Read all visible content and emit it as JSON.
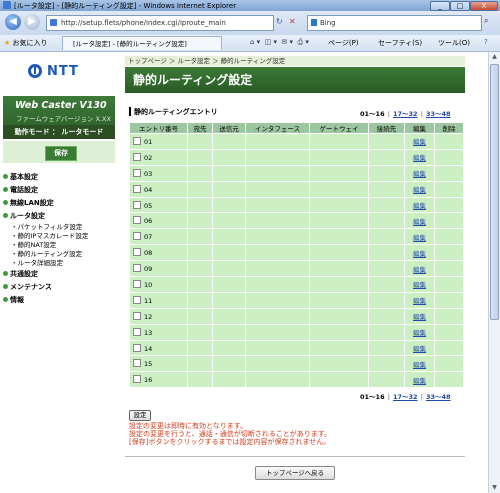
{
  "window": {
    "title": "[ルータ設定] - [静的ルーティング設定] - Windows Internet Explorer",
    "minimize": "_",
    "maximize": "□",
    "close": "X"
  },
  "address_bar": {
    "url": "http://setup.flets/phone/index.cgi/iproute_main",
    "search_provider": "Bing",
    "back_icon": "back-arrow-icon",
    "forward_icon": "forward-arrow-icon",
    "refresh": "↻",
    "stop": "✕",
    "search_icon": "search-icon"
  },
  "favorites_bar": {
    "favorites_label": "お気に入り",
    "tab_title": "[ルータ設定] - [静的ルーティング設定]",
    "page_menu": "ページ(P)",
    "safety_menu": "セーフティ(S)",
    "tools_menu": "ツール(O)",
    "help_menu": "?"
  },
  "sidebar": {
    "logo_text": "NTT",
    "product_name": "Web Caster V130",
    "firmware": "ファームウェアバージョン X.XX",
    "mode": "動作モード ： ルータモード",
    "save_label": "保存",
    "menu": [
      {
        "label": "基本設定"
      },
      {
        "label": "電話設定"
      },
      {
        "label": "無線LAN設定"
      },
      {
        "label": "ルータ設定"
      }
    ],
    "router_submenu": [
      "・パケットフィルタ設定",
      "・静的IPマスカレード設定",
      "・静的NAT設定",
      "・静的ルーティング設定",
      "・ルータ詳細設定"
    ],
    "menu_after": [
      {
        "label": "共通設定"
      },
      {
        "label": "メンテナンス"
      },
      {
        "label": "情報"
      }
    ]
  },
  "main": {
    "breadcrumb": "トップページ ＞ ルータ設定 ＞ 静的ルーティング設定",
    "title": "静的ルーティング設定",
    "section": "静的ルーティングエントリ",
    "pager": {
      "current": "01～16",
      "p2": "17～32",
      "p3": "33～48"
    },
    "columns": [
      "エントリ番号",
      "宛先",
      "送信元",
      "インタフェース",
      "ゲートウェイ",
      "接続先",
      "編集",
      "削除"
    ],
    "rows": [
      {
        "num": "01",
        "edit": "編集"
      },
      {
        "num": "02",
        "edit": "編集"
      },
      {
        "num": "03",
        "edit": "編集"
      },
      {
        "num": "04",
        "edit": "編集"
      },
      {
        "num": "05",
        "edit": "編集"
      },
      {
        "num": "06",
        "edit": "編集"
      },
      {
        "num": "07",
        "edit": "編集"
      },
      {
        "num": "08",
        "edit": "編集"
      },
      {
        "num": "09",
        "edit": "編集"
      },
      {
        "num": "10",
        "edit": "編集"
      },
      {
        "num": "11",
        "edit": "編集"
      },
      {
        "num": "12",
        "edit": "編集"
      },
      {
        "num": "13",
        "edit": "編集"
      },
      {
        "num": "14",
        "edit": "編集"
      },
      {
        "num": "15",
        "edit": "編集"
      },
      {
        "num": "16",
        "edit": "編集"
      }
    ],
    "set_button": "設定",
    "notes": [
      "設定の変更は即時に有効となります。",
      "設定の変更を行うと、通話・通信が切断されることがあります。",
      "[保存]ボタンをクリックするまでは設定内容が保存されません。"
    ],
    "top_button": "トップページへ戻る"
  }
}
